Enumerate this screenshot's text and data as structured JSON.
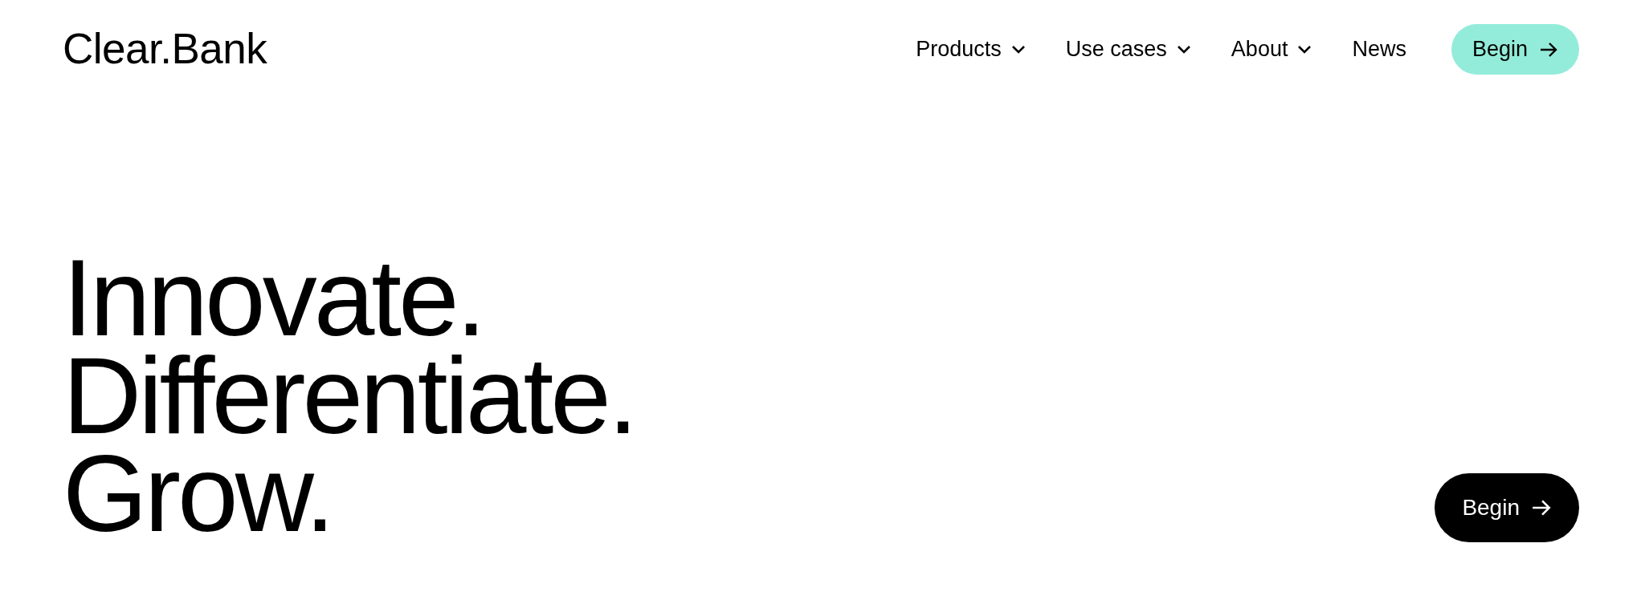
{
  "logo": {
    "text": "Clear.Bank"
  },
  "nav": [
    {
      "label": "Products",
      "has_menu": true
    },
    {
      "label": "Use cases",
      "has_menu": true
    },
    {
      "label": "About",
      "has_menu": true
    },
    {
      "label": "News",
      "has_menu": false
    }
  ],
  "header_button": {
    "label": "Begin",
    "kind": "accent"
  },
  "headline": [
    "Innovate.",
    "Differentiate.",
    "Grow."
  ],
  "hero_button": {
    "label": "Begin",
    "kind": "dark"
  }
}
